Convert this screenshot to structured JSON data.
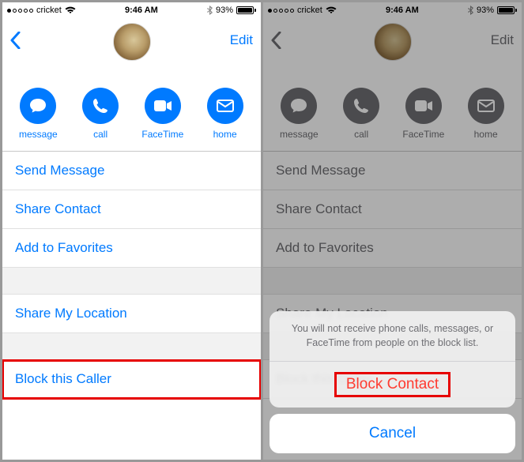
{
  "status": {
    "carrier": "cricket",
    "time": "9:46 AM",
    "battery_pct": "93%",
    "battery_fill": 93
  },
  "nav": {
    "edit_label": "Edit"
  },
  "contact_name": "",
  "actions": {
    "message": "message",
    "call": "call",
    "facetime": "FaceTime",
    "home": "home"
  },
  "cells": {
    "send_message": "Send Message",
    "share_contact": "Share Contact",
    "add_favorites": "Add to Favorites",
    "share_location": "Share My Location",
    "block_caller": "Block this Caller"
  },
  "sheet": {
    "message": "You will not receive phone calls, messages, or FaceTime from people on the block list.",
    "block": "Block Contact",
    "cancel": "Cancel"
  }
}
